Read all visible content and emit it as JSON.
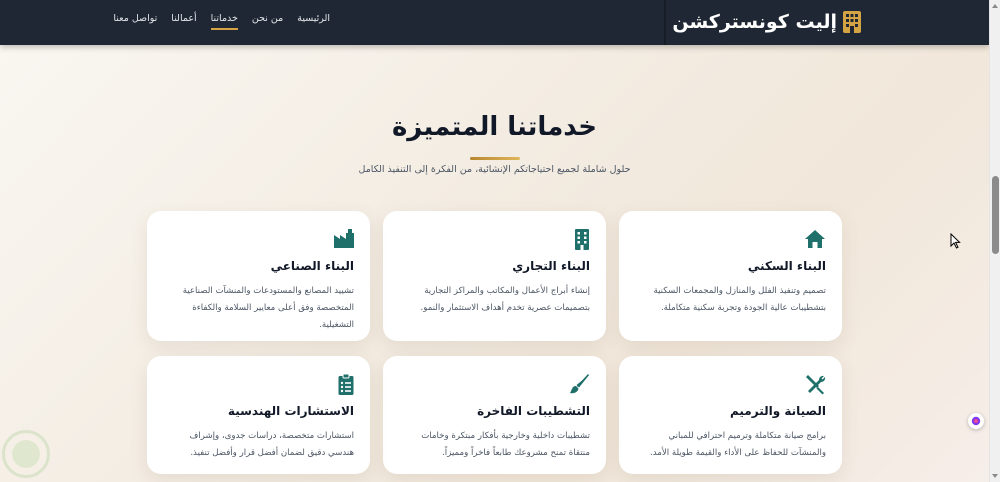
{
  "header": {
    "brand": "إليت كونستركشن",
    "nav": [
      {
        "label": "الرئيسية"
      },
      {
        "label": "من نحن"
      },
      {
        "label": "خدماتنا",
        "active": true
      },
      {
        "label": "أعمالنا"
      },
      {
        "label": "تواصل معنا"
      }
    ]
  },
  "services": {
    "title": "خدماتنا المتميزة",
    "subtitle": "حلول شاملة لجميع احتياجاتكم الإنشائية، من الفكرة إلى التنفيذ الكامل",
    "cards": [
      {
        "icon": "home-icon",
        "title": "البناء السكني",
        "description": "تصميم وتنفيذ الفلل والمنازل والمجمعات السكنية بتشطيبات عالية الجودة وتجربة سكنية متكاملة."
      },
      {
        "icon": "office-building-icon",
        "title": "البناء التجاري",
        "description": "إنشاء أبراج الأعمال والمكاتب والمراكز التجارية بتصميمات عصرية تخدم أهداف الاستثمار والنمو."
      },
      {
        "icon": "factory-icon",
        "title": "البناء الصناعي",
        "description": "تشييد المصانع والمستودعات والمنشآت الصناعية المتخصصة وفق أعلى معايير السلامة والكفاءة التشغيلية."
      },
      {
        "icon": "tools-icon",
        "title": "الصيانة والترميم",
        "description": "برامج صيانة متكاملة وترميم احترافي للمباني والمنشآت للحفاظ على الأداء والقيمة طويلة الأمد."
      },
      {
        "icon": "paint-brush-icon",
        "title": "التشطيبات الفاخرة",
        "description": "تشطيبات داخلية وخارجية بأفكار مبتكرة وخامات منتقاة تمنح مشروعك طابعاً فاخراً ومميزاً."
      },
      {
        "icon": "clipboard-list-icon",
        "title": "الاستشارات الهندسية",
        "description": "استشارات متخصصة، دراسات جدوى، وإشراف هندسي دقيق لضمان أفضل قرار وأفضل تنفيذ."
      }
    ]
  },
  "colors": {
    "header_bg": "#1e2733",
    "accent_gold": "#d4a444",
    "icon_teal": "#1f6f6a"
  }
}
